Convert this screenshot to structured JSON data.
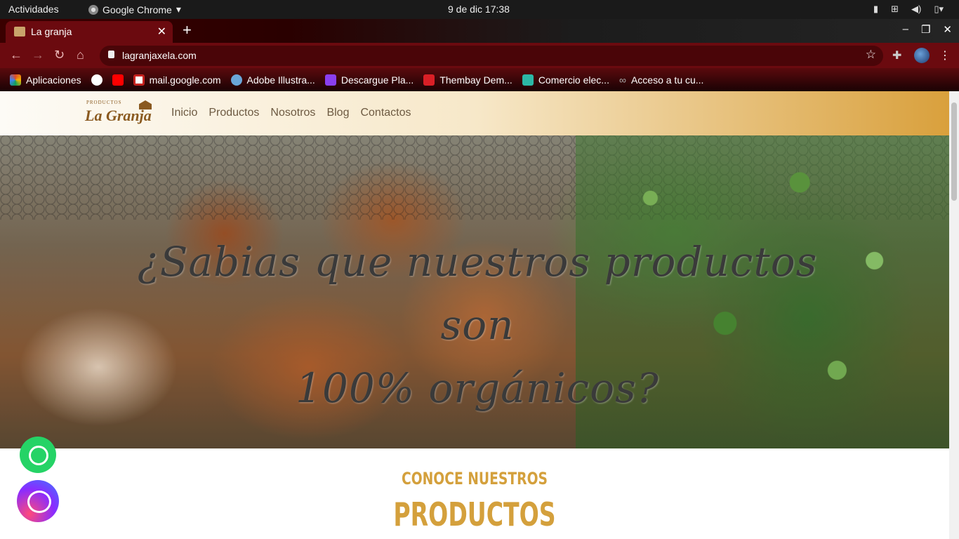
{
  "system_bar": {
    "activities": "Actividades",
    "app_name": "Google Chrome",
    "clock": "9 de dic  17:38"
  },
  "browser": {
    "tab_title": "La granja",
    "url": "lagranjaxela.com",
    "bookmarks": [
      {
        "label": "Aplicaciones",
        "icon": "apps-grid-icon",
        "color": "#e34c26"
      },
      {
        "label": "",
        "icon": "google-icon",
        "color": "#ffffff"
      },
      {
        "label": "",
        "icon": "youtube-icon",
        "color": "#ff0000"
      },
      {
        "label": "mail.google.com",
        "icon": "gmail-icon",
        "color": "#c5221f"
      },
      {
        "label": "Adobe Illustra...",
        "icon": "adobe-icon",
        "color": "#6aa6d8"
      },
      {
        "label": "Descargue Pla...",
        "icon": "plugin-icon",
        "color": "#8a3ff0"
      },
      {
        "label": "Thembay Dem...",
        "icon": "thembay-icon",
        "color": "#d91f26"
      },
      {
        "label": "Comercio elec...",
        "icon": "code-icon",
        "color": "#2cb8a6"
      },
      {
        "label": "Acceso a tu cu...",
        "icon": "link-icon",
        "color": "#888888"
      }
    ]
  },
  "site": {
    "logo_small": "PRODUCTOS",
    "logo_big": "La Granja",
    "menu": [
      "Inicio",
      "Productos",
      "Nosotros",
      "Blog",
      "Contactos"
    ],
    "hero_line1": "¿Sabias que nuestros productos son",
    "hero_line2": "100% orgánicos?",
    "section_subtitle": "CONOCE NUESTROS",
    "section_title": "PRODUCTOS",
    "accent_color": "#d4a03c"
  }
}
